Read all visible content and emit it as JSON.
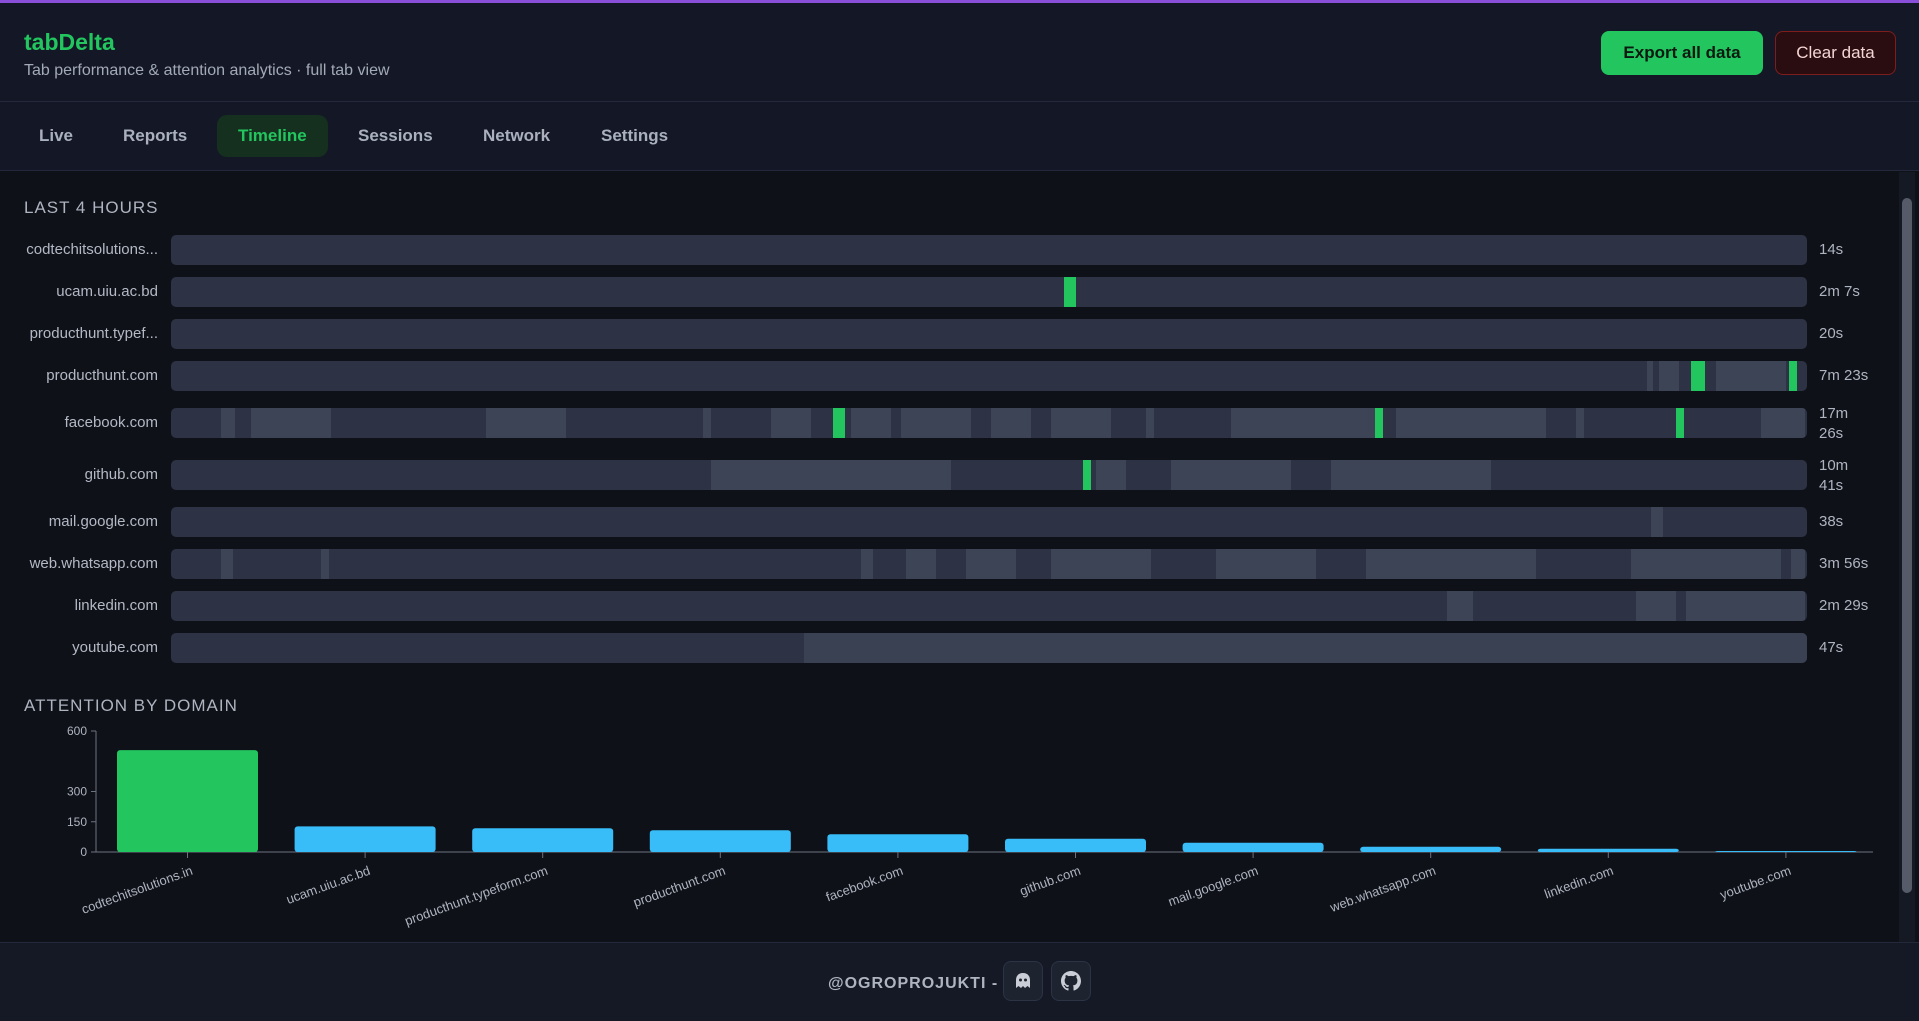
{
  "app": {
    "title": "tabDelta",
    "subtitle": "Tab performance & attention analytics · full tab view",
    "accent_color": "#22c55e"
  },
  "actions": {
    "export_label": "Export all data",
    "clear_label": "Clear data"
  },
  "tabs": [
    {
      "label": "Live",
      "active": false
    },
    {
      "label": "Reports",
      "active": false
    },
    {
      "label": "Timeline",
      "active": true
    },
    {
      "label": "Sessions",
      "active": false
    },
    {
      "label": "Network",
      "active": false
    },
    {
      "label": "Settings",
      "active": false
    }
  ],
  "timeline": {
    "title": "LAST 4 HOURS",
    "rows": [
      {
        "label": "codtechitsolutions...",
        "duration": "14s"
      },
      {
        "label": "ucam.uiu.ac.bd",
        "duration": "2m 7s"
      },
      {
        "label": "producthunt.typef...",
        "duration": "20s"
      },
      {
        "label": "producthunt.com",
        "duration": "7m 23s"
      },
      {
        "label": "facebook.com",
        "duration": "17m 26s"
      },
      {
        "label": "github.com",
        "duration": "10m 41s"
      },
      {
        "label": "mail.google.com",
        "duration": "38s"
      },
      {
        "label": "web.whatsapp.com",
        "duration": "3m 56s"
      },
      {
        "label": "linkedin.com",
        "duration": "2m 29s"
      },
      {
        "label": "youtube.com",
        "duration": "47s"
      }
    ]
  },
  "attention": {
    "title": "ATTENTION BY DOMAIN"
  },
  "chart_data": {
    "type": "bar",
    "categories": [
      "codtechitsolutions.in",
      "ucam.uiu.ac.bd",
      "producthunt.typeform.com",
      "producthunt.com",
      "facebook.com",
      "github.com",
      "mail.google.com",
      "web.whatsapp.com",
      "linkedin.com",
      "youtube.com"
    ],
    "values": [
      505,
      127,
      118,
      108,
      88,
      66,
      46,
      26,
      16,
      3
    ],
    "yticks": [
      0,
      150,
      300,
      600
    ],
    "ylim": [
      0,
      600
    ],
    "highlight_index": 0,
    "colors": {
      "highlight": "#22c55e",
      "default": "#38bdf8"
    }
  },
  "footer": {
    "text": "@OGROPROJUKTI -"
  },
  "footer_icons": [
    "ghost-icon",
    "github-icon"
  ]
}
